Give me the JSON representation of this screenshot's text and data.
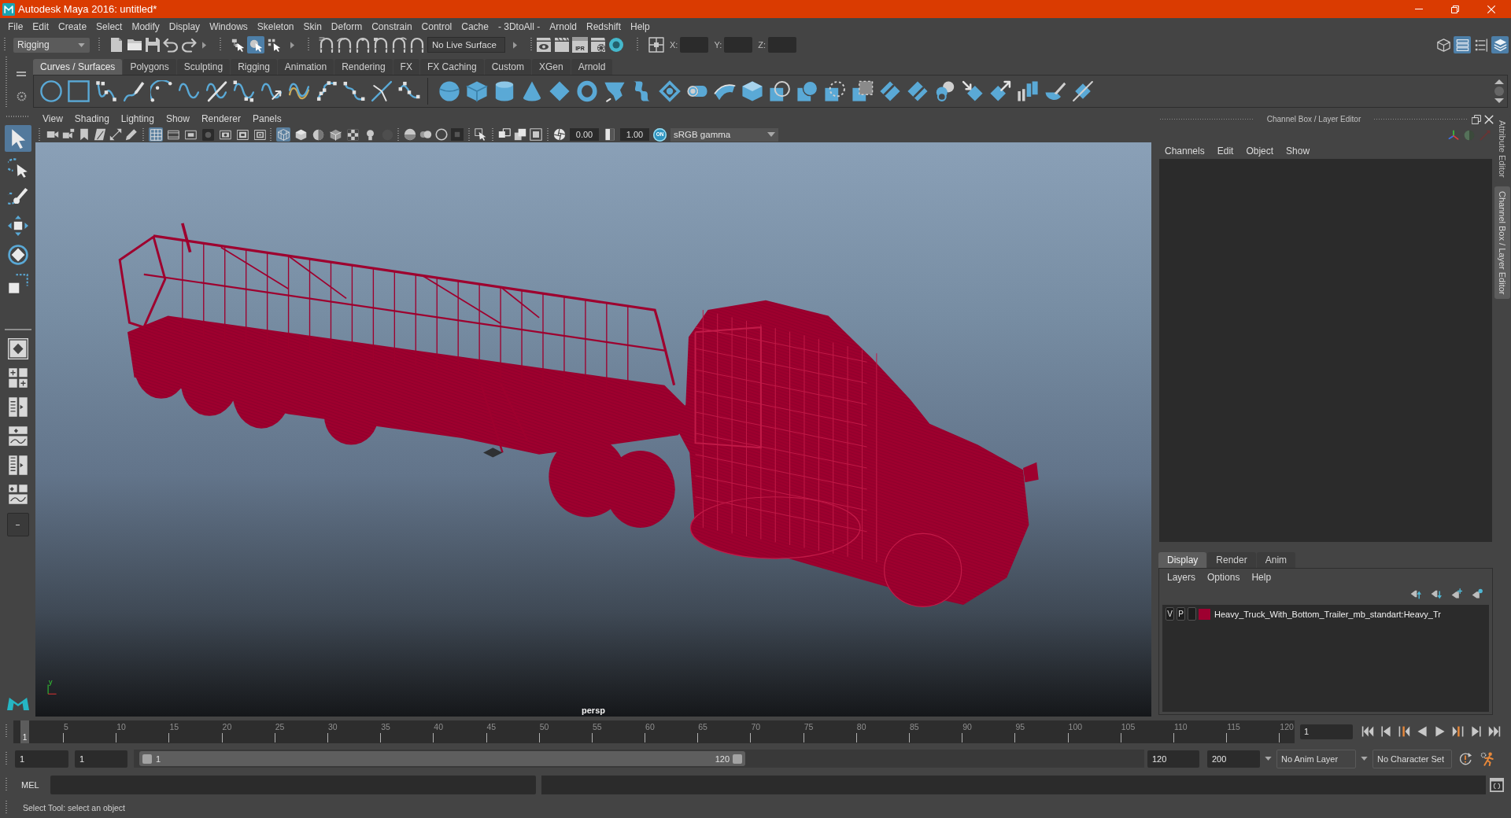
{
  "window": {
    "title": "Autodesk Maya 2016: untitled*"
  },
  "menu_bar": [
    "File",
    "Edit",
    "Create",
    "Select",
    "Modify",
    "Display",
    "Windows",
    "Skeleton",
    "Skin",
    "Deform",
    "Constrain",
    "Control",
    "Cache",
    "- 3DtoAll -",
    "Arnold",
    "Redshift",
    "Help"
  ],
  "status_line": {
    "menu_set": "Rigging",
    "selection_modes": [
      {
        "selected": false
      },
      {
        "selected": true
      },
      {
        "selected": false
      }
    ],
    "live_surface": "No Live Surface",
    "ipr_label": "IPR",
    "coordinates": [
      {
        "label": "X:"
      },
      {
        "label": "Y:"
      },
      {
        "label": "Z:"
      }
    ],
    "panel_toggles": [
      {
        "on": false
      },
      {
        "on": true
      },
      {
        "on": false
      },
      {
        "on": true
      }
    ]
  },
  "shelf": {
    "tabs": [
      {
        "label": "Curves / Surfaces",
        "selected": true
      },
      {
        "label": "Polygons",
        "selected": false
      },
      {
        "label": "Sculpting",
        "selected": false
      },
      {
        "label": "Rigging",
        "selected": false
      },
      {
        "label": "Animation",
        "selected": false
      },
      {
        "label": "Rendering",
        "selected": false
      },
      {
        "label": "FX",
        "selected": false
      },
      {
        "label": "FX Caching",
        "selected": false
      },
      {
        "label": "Custom",
        "selected": false
      },
      {
        "label": "XGen",
        "selected": false
      },
      {
        "label": "Arnold",
        "selected": false
      }
    ]
  },
  "toolbox": {
    "tools": [
      {
        "selected": true
      },
      {
        "selected": false
      },
      {
        "selected": false
      },
      {
        "selected": false
      },
      {
        "selected": false
      },
      {
        "selected": false
      }
    ]
  },
  "viewport": {
    "menus": [
      "View",
      "Shading",
      "Lighting",
      "Show",
      "Renderer",
      "Panels"
    ],
    "gate_toggles": [
      {
        "on": true
      },
      {
        "on": false
      },
      {
        "on": false
      },
      {
        "on": false
      },
      {
        "on": false
      },
      {
        "on": false
      },
      {
        "on": false
      }
    ],
    "shading_toggles": [
      {
        "on": true
      },
      {
        "on": false
      },
      {
        "on": false
      },
      {
        "on": false
      },
      {
        "on": false
      },
      {
        "on": false
      },
      {
        "on": false
      }
    ],
    "exposure": "0.00",
    "gamma": "1.00",
    "color_management": {
      "label": "ON",
      "on": true
    },
    "view_transform": "sRGB gamma",
    "axis_label": "y",
    "camera": "persp"
  },
  "channel_box": {
    "title": "Channel Box / Layer Editor",
    "menus": [
      "Channels",
      "Edit",
      "Object",
      "Show"
    ]
  },
  "layer_editor": {
    "tabs": [
      {
        "label": "Display",
        "selected": true
      },
      {
        "label": "Render",
        "selected": false
      },
      {
        "label": "Anim",
        "selected": false
      }
    ],
    "menus": [
      "Layers",
      "Options",
      "Help"
    ],
    "layers": [
      {
        "visibility": "V",
        "playback": "P",
        "color": "#9e0030",
        "name": "Heavy_Truck_With_Bottom_Trailer_mb_standart:Heavy_Tr"
      }
    ]
  },
  "side_tabs": [
    {
      "label": "Attribute Editor",
      "selected": false
    },
    {
      "label": "Channel Box / Layer Editor",
      "selected": true
    }
  ],
  "time_slider": {
    "playhead": "1",
    "level": 0,
    "ticks": [
      "5",
      "10",
      "15",
      "20",
      "25",
      "30",
      "35",
      "40",
      "45",
      "50",
      "55",
      "60",
      "65",
      "70",
      "75",
      "80",
      "85",
      "90",
      "95",
      "100",
      "105",
      "110",
      "115",
      "120"
    ],
    "current_frame": "1"
  },
  "range_slider": {
    "start_time": "1",
    "playback_start": "1",
    "range_start": "1",
    "range_end": "120",
    "playback_end": "120",
    "end_time": "200",
    "anim_layer": "No Anim Layer",
    "character_set": "No Character Set"
  },
  "command_line": {
    "language": "MEL"
  },
  "help_line": "Select Tool: select an object"
}
